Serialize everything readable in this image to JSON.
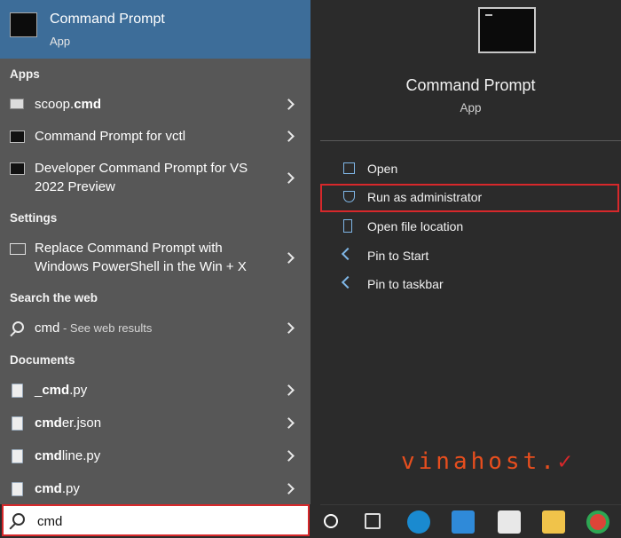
{
  "best_match": {
    "title": "Command Prompt",
    "subtitle": "App"
  },
  "sections": {
    "apps": "Apps",
    "settings": "Settings",
    "search_web": "Search the web",
    "documents": "Documents"
  },
  "apps": [
    {
      "label_bold": "cmd",
      "label_prefix": "scoop.",
      "icon": "scoop-icon"
    },
    {
      "label": "Command Prompt for vctl",
      "icon": "cmd-icon"
    },
    {
      "label_line1": "Developer Command Prompt for VS",
      "label_line2": "2022 Preview",
      "icon": "cmd-icon"
    }
  ],
  "settings": [
    {
      "label_line1": "Replace Command Prompt with",
      "label_line2": "Windows PowerShell in the Win + X",
      "icon": "powershell-settings-icon"
    }
  ],
  "web": {
    "query": "cmd",
    "suffix": " - See web results",
    "icon": "search-icon"
  },
  "documents": [
    {
      "prefix": "_",
      "bold": "cmd",
      "suffix": ".py",
      "icon": "python-file-icon"
    },
    {
      "prefix": "",
      "bold": "cmd",
      "suffix": "er.json",
      "icon": "json-file-icon"
    },
    {
      "prefix": "",
      "bold": "cmd",
      "suffix": "line.py",
      "icon": "python-file-icon"
    },
    {
      "prefix": "",
      "bold": "cmd",
      "suffix": ".py",
      "icon": "python-file-icon"
    }
  ],
  "search": {
    "value": "cmd"
  },
  "detail": {
    "title": "Command Prompt",
    "subtitle": "App",
    "actions": [
      {
        "label": "Open",
        "icon": "open-icon"
      },
      {
        "label": "Run as administrator",
        "icon": "shield-icon"
      },
      {
        "label": "Open file location",
        "icon": "file-location-icon"
      },
      {
        "label": "Pin to Start",
        "icon": "pin-icon"
      },
      {
        "label": "Pin to taskbar",
        "icon": "pin-icon"
      }
    ]
  },
  "taskbar": [
    "task-view-icon",
    "edge-icon",
    "mail-icon",
    "store-icon",
    "file-explorer-icon",
    "chrome-icon"
  ],
  "watermark": "vinahost.",
  "colors": {
    "accent_blue": "#3d6d99",
    "highlight_red": "#d7282b",
    "left_bg": "#575757",
    "right_bg": "#2b2b2b"
  }
}
